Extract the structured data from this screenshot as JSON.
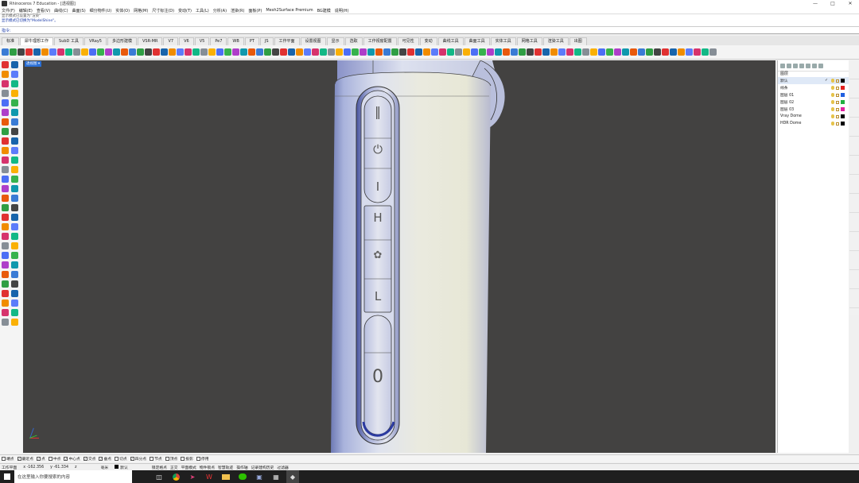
{
  "window": {
    "title": "Rhinoceros 7 Education - [透视图]",
    "controls": [
      "—",
      "□",
      "✕"
    ]
  },
  "menu": [
    "文件(F)",
    "编辑(E)",
    "查看(V)",
    "曲线(C)",
    "曲面(S)",
    "细分物件(U)",
    "实体(O)",
    "网格(M)",
    "尺寸标注(D)",
    "变动(T)",
    "工具(L)",
    "分析(A)",
    "渲染(R)",
    "面板(P)",
    "Mesh2Surface Premium",
    "BG建模",
    "说明(H)"
  ],
  "command_history": [
    {
      "text": "显示模式已设置为\"渲染\"",
      "style": "gray"
    },
    {
      "text": "显示模式已切换为\"ModelShine\"。",
      "style": "blue"
    }
  ],
  "command_prompt": "指令:",
  "toolbar_tabs": [
    {
      "label": "标准",
      "active": false
    },
    {
      "label": "犀牛理想工作",
      "active": true
    },
    {
      "label": "SubD 工具",
      "active": false
    },
    {
      "label": "VRay5",
      "active": false
    },
    {
      "label": "多边形建模",
      "active": false
    },
    {
      "label": "VSR-MR",
      "active": false
    },
    {
      "label": "V7",
      "active": false
    },
    {
      "label": "V6",
      "active": false
    },
    {
      "label": "V5",
      "active": false
    },
    {
      "label": "Pe7",
      "active": false
    },
    {
      "label": "WB",
      "active": false
    },
    {
      "label": "PT",
      "active": false
    },
    {
      "label": "JS",
      "active": false
    },
    {
      "label": "工作平面",
      "active": false
    },
    {
      "label": "设置视图",
      "active": false
    },
    {
      "label": "显示",
      "active": false
    },
    {
      "label": "选取",
      "active": false
    },
    {
      "label": "工作视窗配置",
      "active": false
    },
    {
      "label": "可见性",
      "active": false
    },
    {
      "label": "变动",
      "active": false
    },
    {
      "label": "曲线工具",
      "active": false
    },
    {
      "label": "曲面工具",
      "active": false
    },
    {
      "label": "实体工具",
      "active": false
    },
    {
      "label": "网格工具",
      "active": false
    },
    {
      "label": "渲染工具",
      "active": false
    },
    {
      "label": "出图",
      "active": false
    }
  ],
  "viewport": {
    "label": "透视图 ▾",
    "object_buttons": [
      "‖",
      "⏻",
      "I",
      "H",
      "✿",
      "L",
      "0"
    ]
  },
  "layers_panel": {
    "title": "图层",
    "layers": [
      {
        "name": "默认",
        "current": true,
        "color": "#000000"
      },
      {
        "name": "线条",
        "current": false,
        "color": "#e02020"
      },
      {
        "name": "图层 01",
        "current": false,
        "color": "#2060e0"
      },
      {
        "name": "图层 02",
        "current": false,
        "color": "#20b040"
      },
      {
        "name": "图层 03",
        "current": false,
        "color": "#e020a0"
      },
      {
        "name": "Vray Dome",
        "current": false,
        "color": "#000000"
      },
      {
        "name": "HDR Dome",
        "current": false,
        "color": "#000000"
      }
    ]
  },
  "osnap": [
    {
      "label": "端点",
      "checked": false
    },
    {
      "label": "最近点",
      "checked": true
    },
    {
      "label": "点",
      "checked": true
    },
    {
      "label": "中点",
      "checked": false
    },
    {
      "label": "中心点",
      "checked": true
    },
    {
      "label": "交点",
      "checked": true
    },
    {
      "label": "垂点",
      "checked": true
    },
    {
      "label": "切点",
      "checked": false
    },
    {
      "label": "四分点",
      "checked": true
    },
    {
      "label": "节点",
      "checked": false
    },
    {
      "label": "顶点",
      "checked": false
    },
    {
      "label": "投影",
      "checked": false
    },
    {
      "label": "停用",
      "checked": false
    }
  ],
  "status_bar": {
    "cplane": "工作平面",
    "x": "x -162.356",
    "y": "y -61.334",
    "z": "z",
    "unit": "毫米",
    "layer": "默认",
    "toggles": [
      "锁定格点",
      "正交",
      "平面模式",
      "物件锁点",
      "智慧轨迹",
      "操作轴",
      "记录建构历史",
      "过滤器"
    ]
  },
  "taskbar": {
    "search_placeholder": "在这里输入你要搜索的内容"
  }
}
